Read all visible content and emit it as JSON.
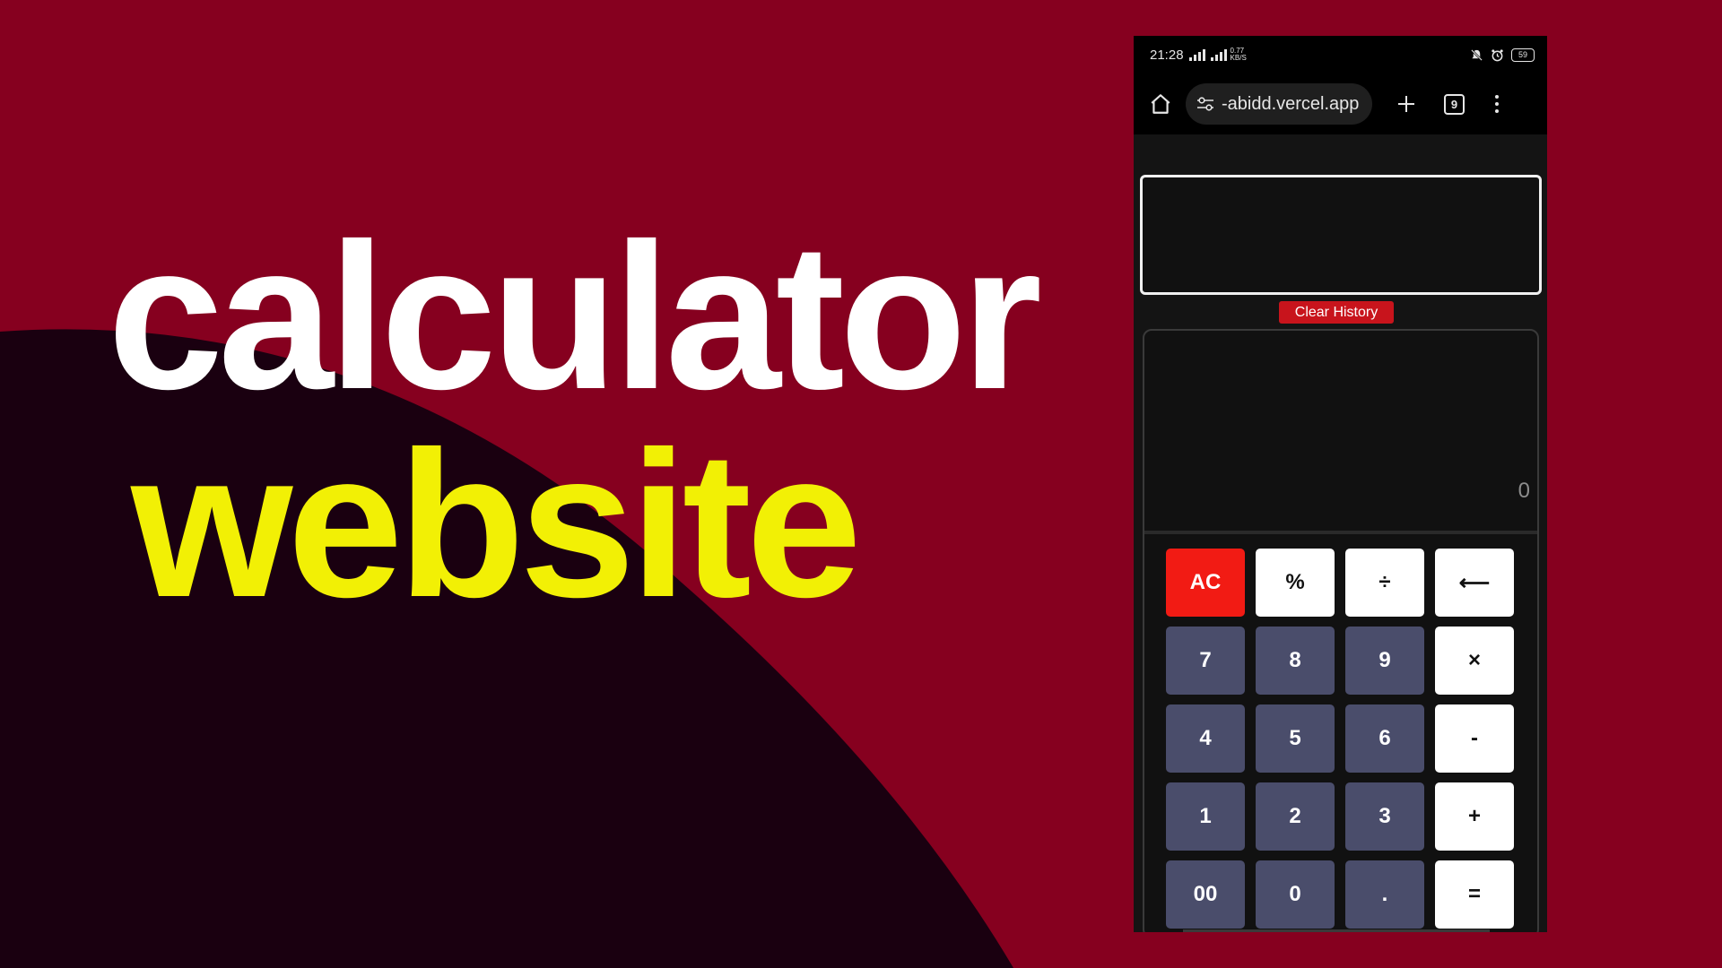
{
  "headline": {
    "line1": "calculator",
    "line2": "website"
  },
  "status_bar": {
    "time": "21:28",
    "net_speed_value": "0.77",
    "net_speed_unit": "KB/S",
    "battery": "59"
  },
  "browser": {
    "url": "-abidd.vercel.app",
    "tab_count": "9"
  },
  "calculator": {
    "clear_history_label": "Clear History",
    "display_value": "0",
    "keys": [
      {
        "label": "AC",
        "kind": "ac"
      },
      {
        "label": "%",
        "kind": "op"
      },
      {
        "label": "÷",
        "kind": "op"
      },
      {
        "label": "⟵",
        "kind": "op"
      },
      {
        "label": "7",
        "kind": "num"
      },
      {
        "label": "8",
        "kind": "num"
      },
      {
        "label": "9",
        "kind": "num"
      },
      {
        "label": "×",
        "kind": "op"
      },
      {
        "label": "4",
        "kind": "num"
      },
      {
        "label": "5",
        "kind": "num"
      },
      {
        "label": "6",
        "kind": "num"
      },
      {
        "label": "-",
        "kind": "op"
      },
      {
        "label": "1",
        "kind": "num"
      },
      {
        "label": "2",
        "kind": "num"
      },
      {
        "label": "3",
        "kind": "num"
      },
      {
        "label": "+",
        "kind": "op"
      },
      {
        "label": "00",
        "kind": "num"
      },
      {
        "label": "0",
        "kind": "num"
      },
      {
        "label": ".",
        "kind": "num"
      },
      {
        "label": "=",
        "kind": "op"
      }
    ]
  },
  "colors": {
    "background": "#86001f",
    "dark_shape": "#1a0010",
    "headline_white": "#ffffff",
    "headline_yellow": "#f2f005",
    "ac_key": "#f21b14",
    "number_key": "#4a4d6b",
    "operator_key": "#ffffff",
    "clear_history_button": "#c8141c"
  },
  "icons": {
    "home": "home-icon",
    "site_settings": "tune-icon",
    "new_tab": "plus-icon",
    "menu": "more-vertical-icon",
    "backspace": "backspace-arrow-icon"
  }
}
